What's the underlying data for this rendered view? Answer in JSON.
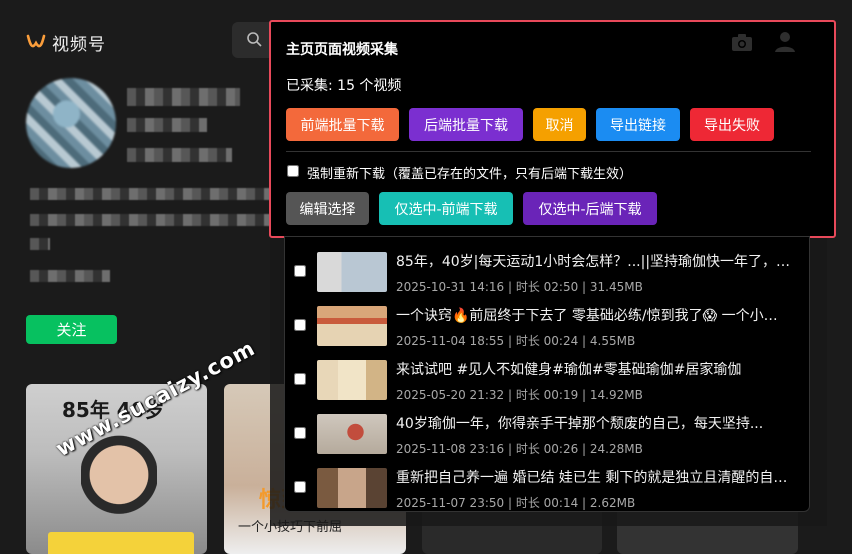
{
  "brand": {
    "name": "视频号",
    "accent": "#fa9d3b"
  },
  "search": {
    "icon": "search-icon"
  },
  "profile": {
    "follow_label": "关注",
    "follow_color": "#07c160"
  },
  "background_cards": {
    "card1_title": "85年 40岁",
    "card2_orange": "惊到",
    "card2_sub": "一个小技巧下前屈"
  },
  "watermark": "www.sucaizy.com",
  "panel": {
    "title": "主页页面视频采集",
    "count_text": "已采集: 15 个视频",
    "border_color": "#e8495a",
    "icons": [
      "camera-icon",
      "user-icon"
    ],
    "buttons": {
      "front_batch": {
        "label": "前端批量下载",
        "color": "#f3693b"
      },
      "back_batch": {
        "label": "后端批量下载",
        "color": "#7b2fd0"
      },
      "cancel": {
        "label": "取消",
        "color": "#f5a000"
      },
      "export_links": {
        "label": "导出链接",
        "color": "#1b8cf2"
      },
      "export_failed": {
        "label": "导出失败",
        "color": "#ee2835"
      },
      "edit_select": {
        "label": "编辑选择",
        "color": "#555555"
      },
      "selected_front": {
        "label": "仅选中-前端下载",
        "color": "#17bfb4"
      },
      "selected_back": {
        "label": "仅选中-后端下载",
        "color": "#6a24b8"
      }
    },
    "force_redownload": {
      "checked": false,
      "label": "强制重新下载（覆盖已存在的文件，只有后端下载生效）"
    }
  },
  "videos": [
    {
      "title": "85年，40岁|每天运动1小时会怎样？...||坚持瑜伽快一年了，记录...",
      "date": "2025-10-31 14:16",
      "duration": "时长 02:50",
      "size": "31.45MB"
    },
    {
      "title": "一个诀窍🔥前屈终于下去了 零基础必练/惊到我了😱 一个小技巧下前屈...",
      "date": "2025-11-04 18:55",
      "duration": "时长 00:24",
      "size": "4.55MB"
    },
    {
      "title": "来试试吧 #见人不如健身#瑜伽#零基础瑜伽#居家瑜伽",
      "date": "2025-05-20 21:32",
      "duration": "时长 00:19",
      "size": "14.92MB"
    },
    {
      "title": "40岁瑜伽一年，你得亲手干掉那个颓废的自己，每天坚持...",
      "date": "2025-11-08 23:16",
      "duration": "时长 00:26",
      "size": "24.28MB"
    },
    {
      "title": "重新把自己养一遍 婚已结 娃已生 剩下的就是独立且清醒的自己...",
      "date": "2025-11-07 23:50",
      "duration": "时长 00:14",
      "size": "2.62MB"
    }
  ]
}
